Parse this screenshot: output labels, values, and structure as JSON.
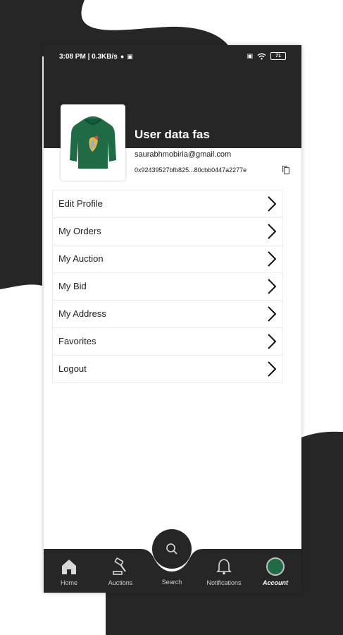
{
  "status_bar": {
    "time_speed": "3:08 PM | 0.3KB/s",
    "battery": "71"
  },
  "profile": {
    "name": "User data fas",
    "email": "saurabhmobiria@gmail.com",
    "wallet_address": "0x92439527bfb825...80cbb0447a2277e"
  },
  "menu": {
    "items": [
      {
        "label": "Edit Profile"
      },
      {
        "label": "My Orders"
      },
      {
        "label": "My Auction"
      },
      {
        "label": "My Bid"
      },
      {
        "label": "My Address"
      },
      {
        "label": "Favorites"
      },
      {
        "label": "Logout"
      }
    ]
  },
  "bottom_nav": {
    "items": [
      {
        "label": "Home",
        "icon": "home-icon"
      },
      {
        "label": "Auctions",
        "icon": "gavel-icon"
      },
      {
        "label": "Search",
        "icon": "search-icon"
      },
      {
        "label": "Notifications",
        "icon": "bell-icon"
      },
      {
        "label": "Account",
        "icon": "avatar"
      }
    ],
    "active": "Account"
  },
  "colors": {
    "dark": "#262626",
    "accent_green": "#1e6b46",
    "background": "#ffffff"
  }
}
